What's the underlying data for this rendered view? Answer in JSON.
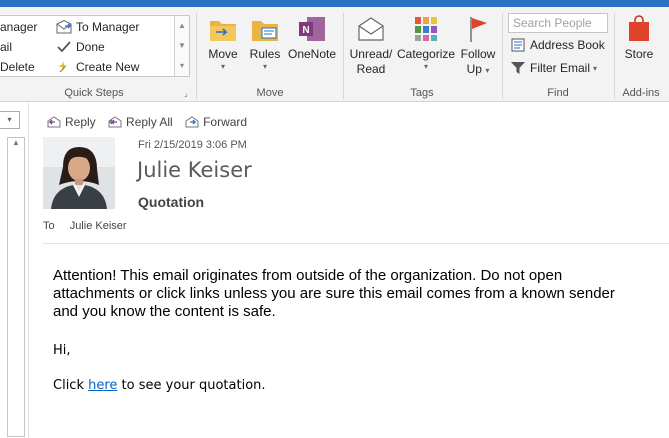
{
  "ribbon": {
    "quick_steps": {
      "items": [
        "anager",
        "ail",
        "Delete",
        "To Manager",
        "Done",
        "Create New"
      ],
      "group_label": "Quick Steps"
    },
    "move": {
      "buttons": [
        "Move",
        "Rules",
        "OneNote"
      ],
      "group_label": "Move"
    },
    "tags": {
      "unread_read_line1": "Unread/",
      "unread_read_line2": "Read",
      "categorize": "Categorize",
      "follow_up_line1": "Follow",
      "follow_up_line2": "Up",
      "group_label": "Tags"
    },
    "find": {
      "search_placeholder": "Search People",
      "address_book": "Address Book",
      "filter_email": "Filter Email",
      "group_label": "Find"
    },
    "addins": {
      "store": "Store",
      "group_label": "Add-ins"
    }
  },
  "message": {
    "actions": {
      "reply": "Reply",
      "reply_all": "Reply All",
      "forward": "Forward"
    },
    "date": "Fri 2/15/2019 3:06 PM",
    "sender": "Julie Keiser",
    "subject": "Quotation",
    "to_label": "To",
    "to_name": "Julie Keiser",
    "warning": "Attention! This email originates from outside of the organization. Do not open attachments or click links unless you are sure this email comes from a known sender and you know the content is safe.",
    "greeting": "Hi,",
    "click_prefix": "Click ",
    "link_text": "here",
    "click_suffix": " to see your quotation."
  },
  "colors": {
    "accent": "#2b72c4",
    "link": "#0563c1",
    "store_red": "#e0432d",
    "onenote_purple": "#80397b",
    "folder_yellow": "#e8b544"
  }
}
